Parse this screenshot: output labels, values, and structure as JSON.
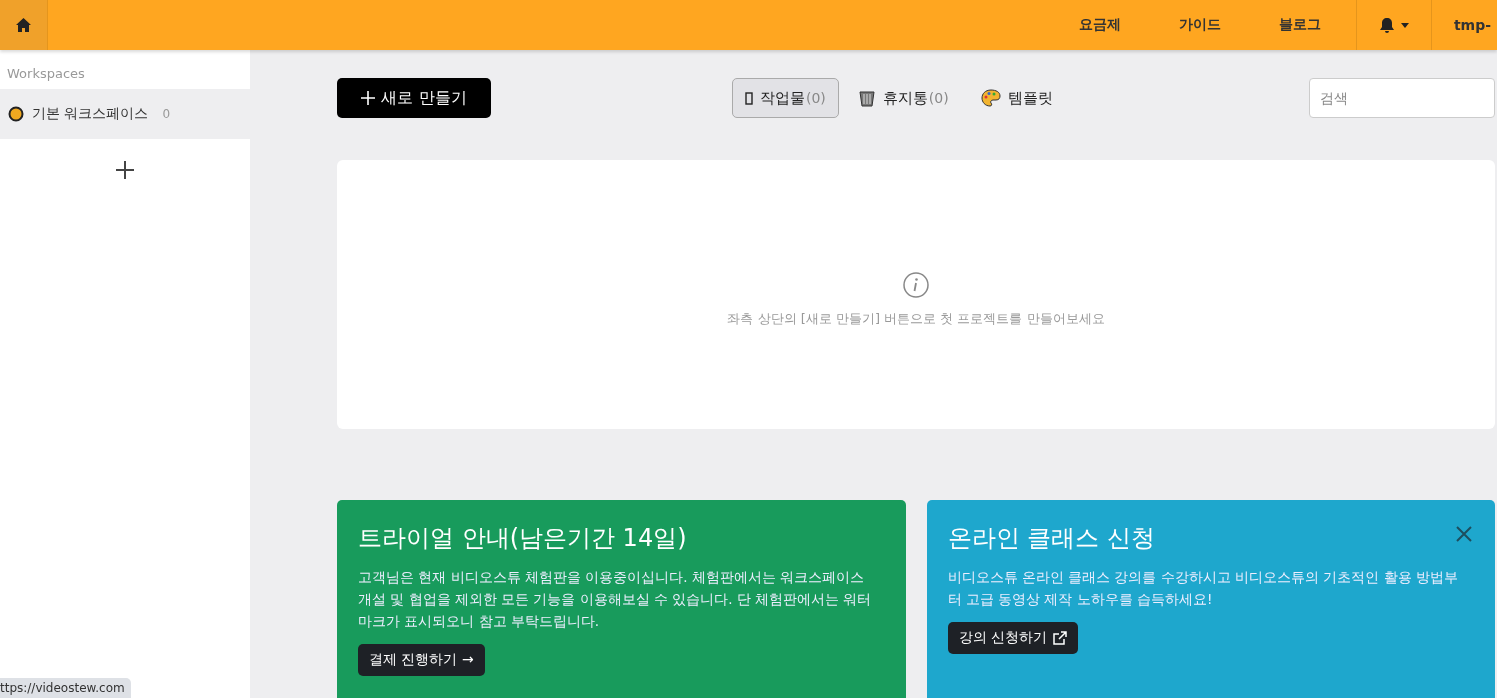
{
  "topbar": {
    "links": [
      "요금제",
      "가이드",
      "블로그"
    ],
    "user": "tmp-"
  },
  "sidebar": {
    "heading": "Workspaces",
    "items": [
      {
        "label": "기본 워크스페이스",
        "count": "0",
        "selected": true
      }
    ]
  },
  "toolbar": {
    "new_button": "새로 만들기",
    "tabs": [
      {
        "kind": "projects",
        "label": "작업물",
        "count": "(0)",
        "selected": true
      },
      {
        "kind": "trash",
        "label": "휴지통",
        "count": "(0)",
        "selected": false
      },
      {
        "kind": "templates",
        "label": "템플릿",
        "selected": false
      }
    ],
    "search": {
      "placeholder": "검색"
    }
  },
  "empty_state": {
    "message": "좌측 상단의 [새로 만들기] 버튼으로 첫 프로젝트를 만들어보세요"
  },
  "cards": [
    {
      "kind": "trial",
      "title": "트라이얼 안내(남은기간 14일)",
      "body": "고객님은 현재 비디오스튜 체험판을 이용중이십니다. 체험판에서는 워크스페이스 개설 및 협업을 제외한 모든 기능을 이용해보실 수 있습니다. 단 체험판에서는 워터마크가 표시되오니 참고 부탁드립니다.",
      "button": "결제 진행하기 →",
      "color": "#189b5c",
      "closable": false
    },
    {
      "kind": "class",
      "title": "온라인 클래스 신청",
      "body": "비디오스튜 온라인 클래스 강의를 수강하시고 비디오스튜의 기초적인 활용 방법부터 고급 동영상 제작 노하우를 습득하세요!",
      "button": "강의 신청하기",
      "color": "#1ea7cd",
      "closable": true
    }
  ],
  "status_url": "ttps://videostew.com"
}
